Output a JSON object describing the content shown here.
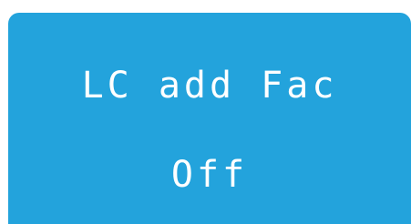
{
  "display": {
    "parameter_label": "LC add Fac",
    "parameter_value": "Off"
  },
  "colors": {
    "panel_background": "#23a3dc",
    "text": "#ffffff",
    "page_background": "#ffffff"
  }
}
